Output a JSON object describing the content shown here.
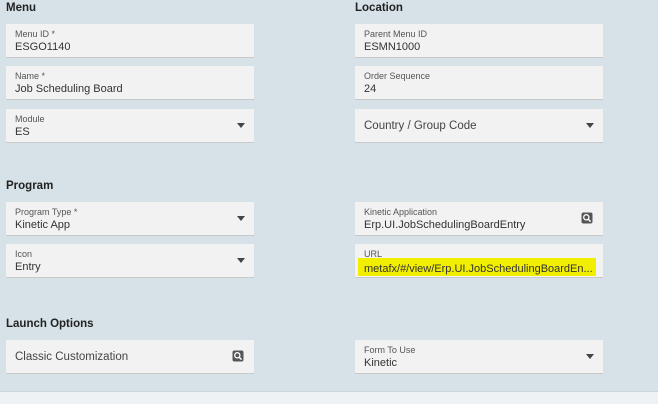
{
  "sections": {
    "menu": "Menu",
    "location": "Location",
    "program": "Program",
    "launch_options": "Launch Options"
  },
  "fields": {
    "menu_id": {
      "label": "Menu ID *",
      "value": "ESGO1140"
    },
    "parent_menu_id": {
      "label": "Parent Menu ID",
      "value": "ESMN1000"
    },
    "name": {
      "label": "Name *",
      "value": "Job Scheduling Board"
    },
    "order_sequence": {
      "label": "Order Sequence",
      "value": "24"
    },
    "module": {
      "label": "Module",
      "value": "ES"
    },
    "country_group_code": {
      "value": "Country / Group Code"
    },
    "program_type": {
      "label": "Program Type *",
      "value": "Kinetic App"
    },
    "kinetic_application": {
      "label": "Kinetic Application",
      "value": "Erp.UI.JobSchedulingBoardEntry"
    },
    "icon": {
      "label": "Icon",
      "value": "Entry"
    },
    "url": {
      "label": "URL",
      "value": "metafx/#/view/Erp.UI.JobSchedulingBoardEn..."
    },
    "classic_customization": {
      "value": "Classic Customization"
    },
    "form_to_use": {
      "label": "Form To Use",
      "value": "Kinetic"
    }
  },
  "icons": {
    "dropdown": "chevron-down-icon",
    "lookup": "search-lookup-icon"
  },
  "colors": {
    "background": "#d6e2e8",
    "field": "#f2f2f2",
    "highlight": "#f1ee00"
  }
}
